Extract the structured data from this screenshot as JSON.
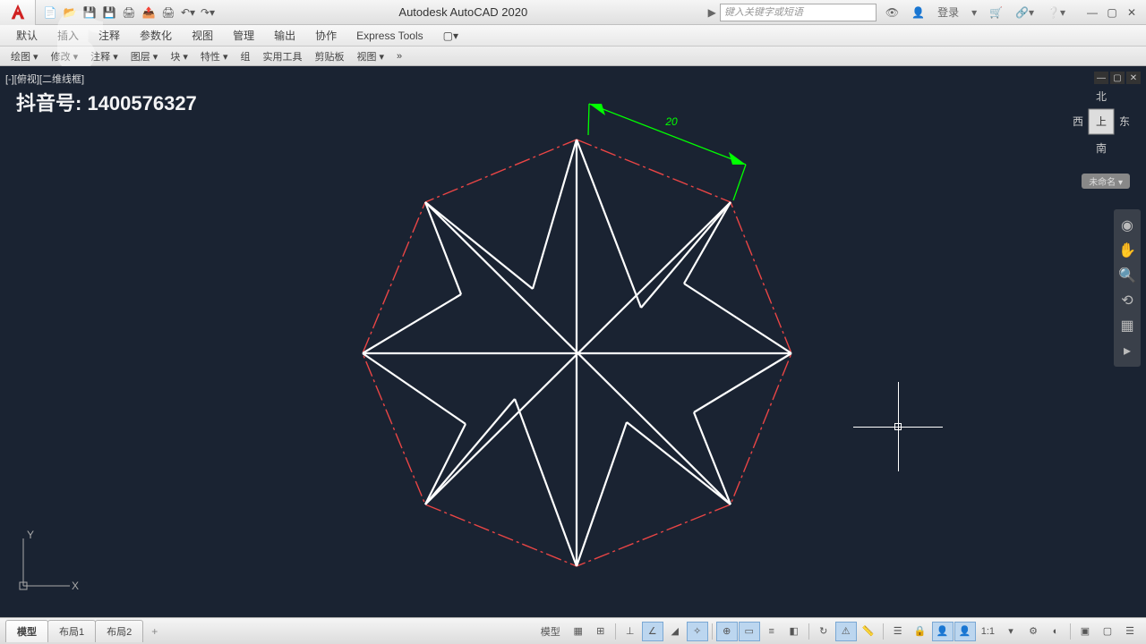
{
  "app": {
    "title": "Autodesk AutoCAD 2020"
  },
  "search": {
    "placeholder": "键入关键字或短语"
  },
  "login": {
    "label": "登录"
  },
  "menus": [
    "默认",
    "插入",
    "注释",
    "参数化",
    "视图",
    "管理",
    "输出",
    "协作",
    "Express Tools"
  ],
  "panels": [
    "绘图 ▾",
    "修改 ▾",
    "注释 ▾",
    "图层 ▾",
    "块 ▾",
    "特性 ▾",
    "组",
    "实用工具",
    "剪贴板",
    "视图 ▾",
    "»"
  ],
  "viewport": {
    "label": "[-][俯视][二维线框]"
  },
  "watermark": {
    "text": "抖音号: 1400576327"
  },
  "dimension": {
    "value": "20"
  },
  "viewcube": {
    "n": "北",
    "s": "南",
    "w": "西",
    "e": "东",
    "top": "上"
  },
  "unnamed": {
    "label": "未命名 ▾"
  },
  "tabs": {
    "model": "模型",
    "layout1": "布局1",
    "layout2": "布局2"
  },
  "status": {
    "model_label": "模型",
    "scale": "1:1"
  },
  "colors": {
    "canvas": "#1a2332",
    "dim_green": "#00ff00",
    "dash_red": "#e94545",
    "line_white": "#ffffff"
  }
}
